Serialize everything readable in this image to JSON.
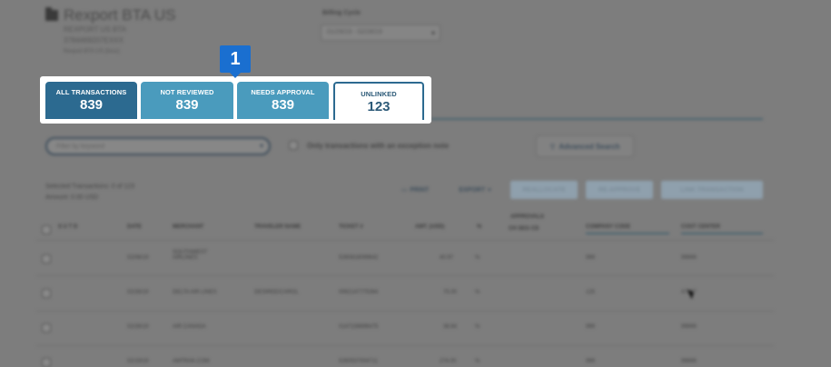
{
  "header": {
    "title": "Rexport BTA US",
    "sub_lines": [
      "REXPORT US BTA",
      "3784469207EXXX",
      "Rexport BTA US (5xxx)"
    ],
    "billing_label": "Billing Cycle",
    "billing_value": "01/29/19 - 02/28/19"
  },
  "callout": {
    "number": "1"
  },
  "tabs": [
    {
      "label": "ALL TRANSACTIONS",
      "count": "839"
    },
    {
      "label": "NOT REVIEWED",
      "count": "839"
    },
    {
      "label": "NEEDS APPROVAL",
      "count": "839"
    },
    {
      "label": "UNLINKED",
      "count": "123"
    }
  ],
  "filters": {
    "keyword_placeholder": "Filter by keyword",
    "exception_label": "Only transactions with an exception note",
    "advanced_search": "Advanced Search"
  },
  "selection": {
    "line1": "Selected Transactions: 0 of 123",
    "line2": "Amount: 0.00 USD"
  },
  "toolbar": {
    "print": "PRINT",
    "export": "EXPORT",
    "btn1": "REALLOCATE",
    "btn2": "RE-APPROVE",
    "btn3": "LINK TRANSACTION"
  },
  "table": {
    "headers": {
      "status": "S  U  T  D",
      "date": "DATE",
      "merchant": "MERCHANT",
      "traveler": "TRAVELER NAME",
      "ticket": "TICKET #",
      "amount": "AMT. (USD)",
      "pct": "%",
      "approvals": "APPROVALS",
      "approvals_sub": "CH  SEG  CD",
      "company": "COMPANY CODE",
      "cost_center": "COST CENTER"
    },
    "rows": [
      {
        "date": "02/06/19",
        "merchant": "SOUTHWEST AIRLINES",
        "traveler": "",
        "ticket": "5260818099642",
        "amount": "40.97",
        "pct": "%",
        "company": "999",
        "cost": "99999"
      },
      {
        "date": "02/26/19",
        "merchant": "DELTA AIR LINES",
        "traveler": "DESIREE/CAROL",
        "ticket": "0062147775364",
        "amount": "75.00",
        "pct": "%",
        "company": "125",
        "cost": "47187"
      },
      {
        "date": "02/26/19",
        "merchant": "AIR CANADA",
        "traveler": "",
        "ticket": "0147238896475",
        "amount": "38.64",
        "pct": "%",
        "company": "999",
        "cost": "99999"
      },
      {
        "date": "02/19/19",
        "merchant": "AMTRAK.COM",
        "traveler": "",
        "ticket": "5260537004711",
        "amount": "274.00",
        "pct": "%",
        "company": "999",
        "cost": "99999"
      }
    ]
  }
}
